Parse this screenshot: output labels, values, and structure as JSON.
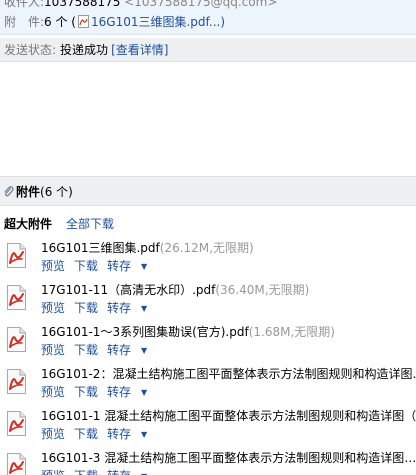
{
  "header": {
    "from_label": "收件人:",
    "from_name": "1037588175",
    "from_addr": "<1037588175@qq.com>",
    "attach_label": "附　件:",
    "attach_count": "6 个 (",
    "attach_first": "16G101三维图集.pdf...)"
  },
  "status": {
    "label": "发送状态:",
    "value": "投递成功",
    "details_link": "[查看详情]"
  },
  "attachments": {
    "title": "附件",
    "count": "(6 个)",
    "super_label": "超大附件",
    "download_all": "全部下载",
    "files": [
      {
        "name": "16G101三维图集.pdf",
        "size": "(26.12M,无限期)"
      },
      {
        "name": "17G101-11（高清无水印）.pdf",
        "size": "(36.40M,无限期)"
      },
      {
        "name": "16G101-1～3系列图集勘误(官方).pdf",
        "size": "(1.68M,无限期)"
      },
      {
        "name": "16G101-2：混凝土结构施工图平面整体表示方法制图规则和构造详图…",
        "size": ""
      },
      {
        "name": "16G101-1 混凝土结构施工图平面整体表示方法制图规则和构造详图（",
        "size": ""
      },
      {
        "name": "16G101-3 混凝土结构施工图平面整体表示方法制图规则和构造详图…",
        "size": ""
      }
    ],
    "actions": {
      "preview": "预览",
      "download": "下载",
      "save": "转存"
    }
  },
  "colors": {
    "link": "#1f4f9e",
    "pdf_red": "#d42b1f",
    "header_bg": "#eef4fc"
  }
}
